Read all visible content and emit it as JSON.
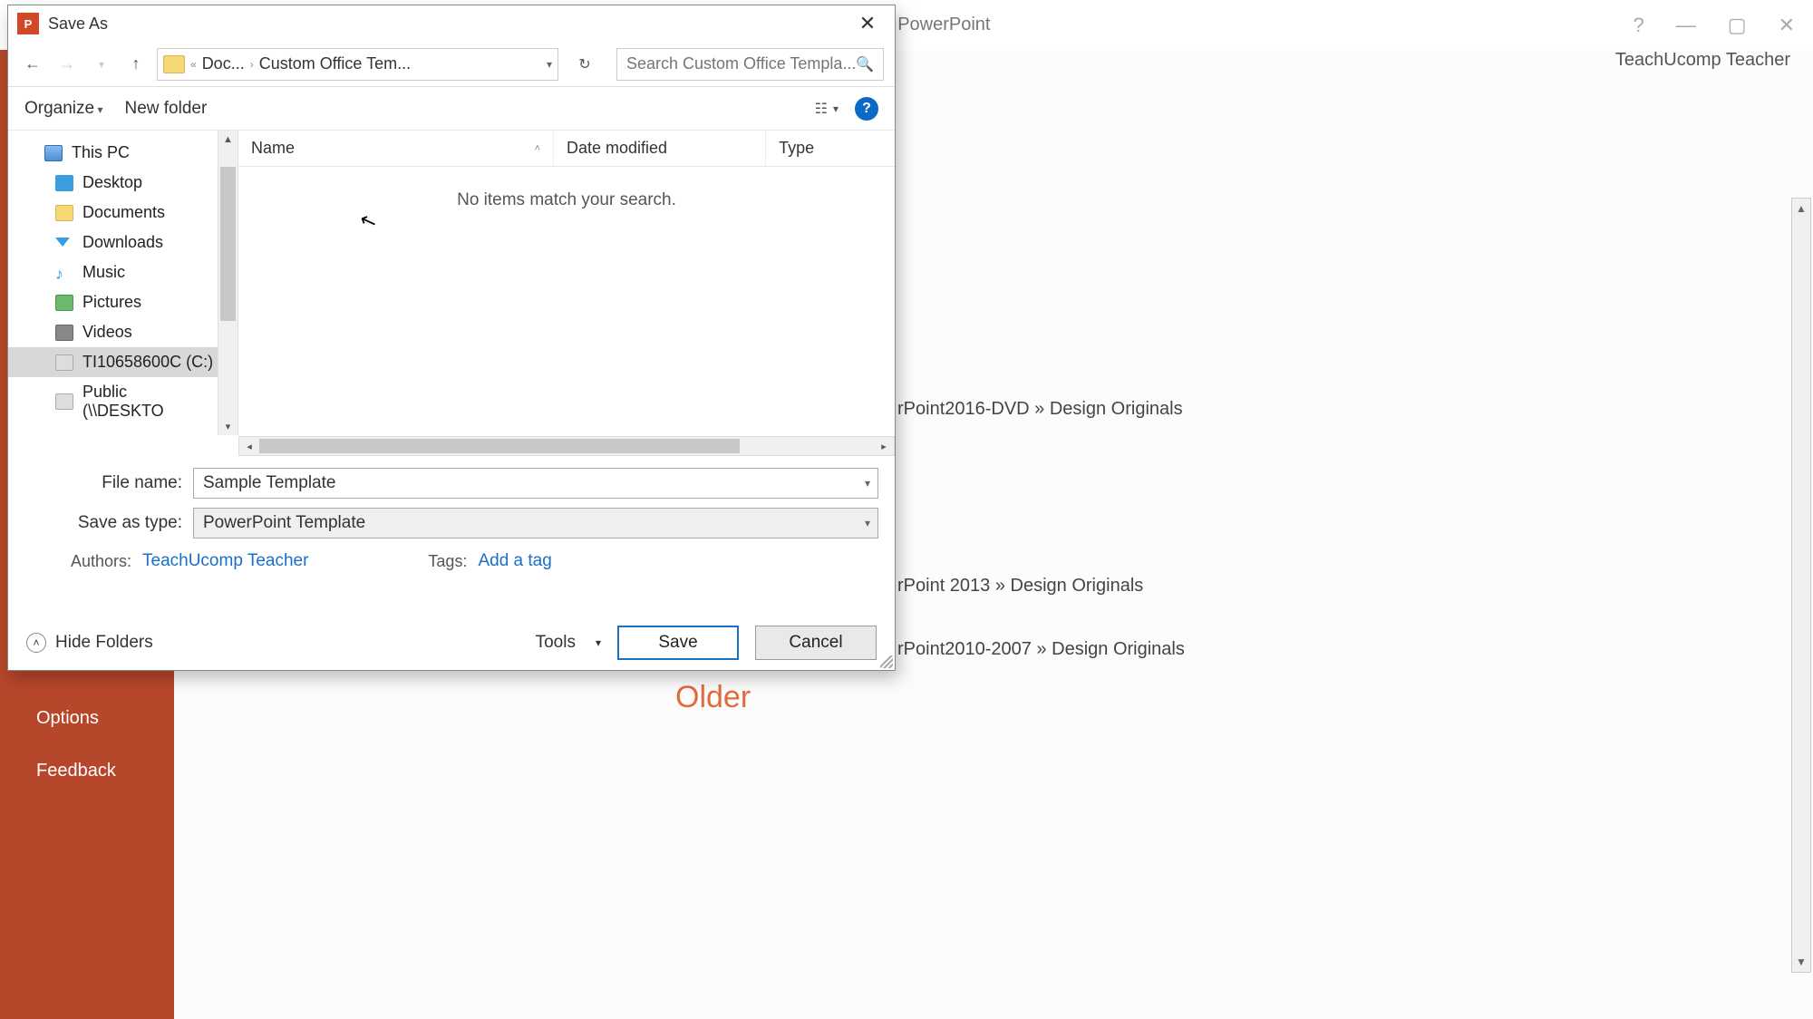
{
  "app": {
    "title_suffix": "ation - PowerPoint",
    "user": "TeachUcomp Teacher"
  },
  "backstage": {
    "options": "Options",
    "feedback": "Feedback"
  },
  "bg_paths": {
    "p1": "rPoint2016-DVD » Design Originals",
    "p2": "rPoint 2013 » Design Originals",
    "p3": "rPoint2010-2007 » Design Originals",
    "older": "Older"
  },
  "dialog": {
    "title": "Save As",
    "breadcrumb": {
      "seg1": "Doc...",
      "seg2": "Custom Office Tem..."
    },
    "search_placeholder": "Search Custom Office Templa...",
    "toolbar": {
      "organize": "Organize",
      "new_folder": "New folder"
    },
    "tree": {
      "this_pc": "This PC",
      "desktop": "Desktop",
      "documents": "Documents",
      "downloads": "Downloads",
      "music": "Music",
      "pictures": "Pictures",
      "videos": "Videos",
      "drive_c": "TI10658600C (C:)",
      "network": "Public (\\\\DESKTO"
    },
    "columns": {
      "name": "Name",
      "date": "Date modified",
      "type": "Type"
    },
    "empty": "No items match your search.",
    "filename_label": "File name:",
    "filename_value": "Sample Template",
    "savetype_label": "Save as type:",
    "savetype_value": "PowerPoint Template",
    "authors_label": "Authors:",
    "authors_value": "TeachUcomp Teacher",
    "tags_label": "Tags:",
    "tags_value": "Add a tag",
    "hide_folders": "Hide Folders",
    "tools": "Tools",
    "save": "Save",
    "cancel": "Cancel"
  }
}
